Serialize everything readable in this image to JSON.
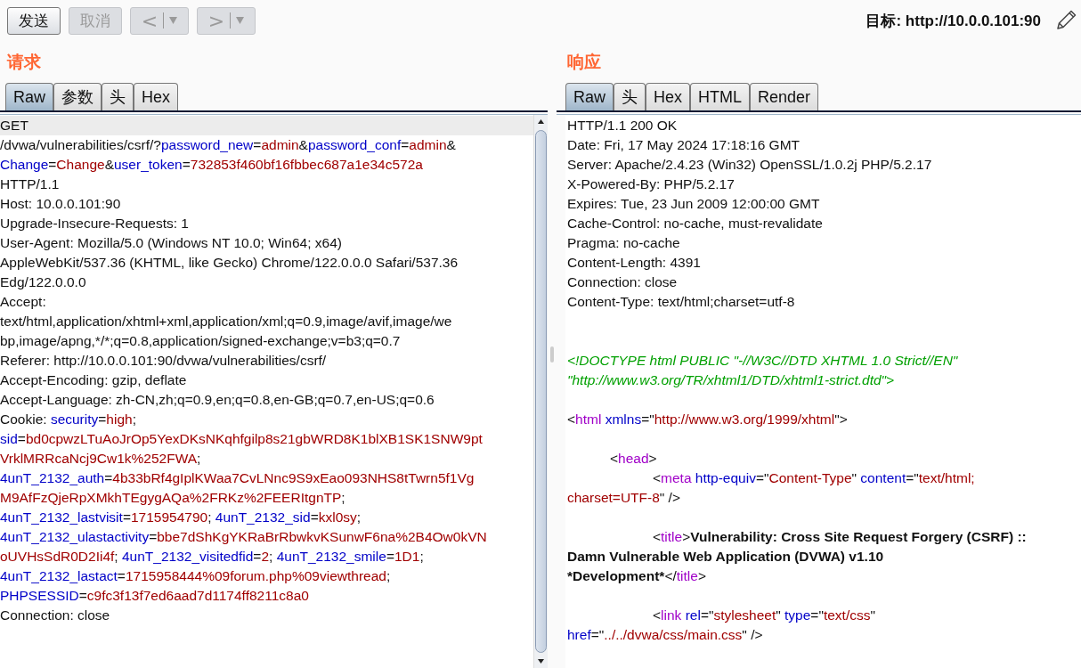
{
  "toolbar": {
    "buttons": [
      {
        "kind": "text",
        "label": "发送",
        "disabled": false
      },
      {
        "kind": "text",
        "label": "取消",
        "disabled": true
      },
      {
        "kind": "split",
        "label": "<",
        "disabled": true
      },
      {
        "kind": "split",
        "label": ">",
        "disabled": true
      }
    ],
    "target": "目标: http://10.0.0.101:90"
  },
  "request": {
    "heading": "请求",
    "tabs": [
      {
        "label": "Raw",
        "selected": true
      },
      {
        "label": "参数",
        "selected": false
      },
      {
        "label": "头",
        "selected": false
      },
      {
        "label": "Hex",
        "selected": false
      }
    ],
    "lines": [
      {
        "current": true,
        "segments": [
          {
            "kind": "plain",
            "text": "GET"
          }
        ]
      },
      {
        "current": false,
        "segments": [
          {
            "kind": "plain",
            "text": "/dvwa/vulnerabilities/csrf/?"
          },
          {
            "kind": "name",
            "text": "password_new"
          },
          {
            "kind": "plain",
            "text": "="
          },
          {
            "kind": "value",
            "text": "admin"
          },
          {
            "kind": "plain",
            "text": "&"
          },
          {
            "kind": "name",
            "text": "password_conf"
          },
          {
            "kind": "plain",
            "text": "="
          },
          {
            "kind": "value",
            "text": "admin"
          },
          {
            "kind": "plain",
            "text": "&"
          }
        ]
      },
      {
        "current": false,
        "segments": [
          {
            "kind": "name",
            "text": "Change"
          },
          {
            "kind": "plain",
            "text": "="
          },
          {
            "kind": "value",
            "text": "Change"
          },
          {
            "kind": "plain",
            "text": "&"
          },
          {
            "kind": "name",
            "text": "user_token"
          },
          {
            "kind": "plain",
            "text": "="
          },
          {
            "kind": "value",
            "text": "732853f460bf16fbbec687a1e34c572a"
          }
        ]
      },
      {
        "current": false,
        "segments": [
          {
            "kind": "plain",
            "text": "HTTP/1.1"
          }
        ]
      },
      {
        "current": false,
        "segments": [
          {
            "kind": "plain",
            "text": "Host: 10.0.0.101:90"
          }
        ]
      },
      {
        "current": false,
        "segments": [
          {
            "kind": "plain",
            "text": "Upgrade-Insecure-Requests: 1"
          }
        ]
      },
      {
        "current": false,
        "segments": [
          {
            "kind": "plain",
            "text": "User-Agent: Mozilla/5.0 (Windows NT 10.0; Win64; x64)"
          }
        ]
      },
      {
        "current": false,
        "segments": [
          {
            "kind": "plain",
            "text": "AppleWebKit/537.36 (KHTML, like Gecko) Chrome/122.0.0.0 Safari/537.36"
          }
        ]
      },
      {
        "current": false,
        "segments": [
          {
            "kind": "plain",
            "text": "Edg/122.0.0.0"
          }
        ]
      },
      {
        "current": false,
        "segments": [
          {
            "kind": "plain",
            "text": "Accept:"
          }
        ]
      },
      {
        "current": false,
        "segments": [
          {
            "kind": "plain",
            "text": "text/html,application/xhtml+xml,application/xml;q=0.9,image/avif,image/we"
          }
        ]
      },
      {
        "current": false,
        "segments": [
          {
            "kind": "plain",
            "text": "bp,image/apng,*/*;q=0.8,application/signed-exchange;v=b3;q=0.7"
          }
        ]
      },
      {
        "current": false,
        "segments": [
          {
            "kind": "plain",
            "text": "Referer: http://10.0.0.101:90/dvwa/vulnerabilities/csrf/"
          }
        ]
      },
      {
        "current": false,
        "segments": [
          {
            "kind": "plain",
            "text": "Accept-Encoding: gzip, deflate"
          }
        ]
      },
      {
        "current": false,
        "segments": [
          {
            "kind": "plain",
            "text": "Accept-Language: zh-CN,zh;q=0.9,en;q=0.8,en-GB;q=0.7,en-US;q=0.6"
          }
        ]
      },
      {
        "current": false,
        "segments": [
          {
            "kind": "plain",
            "text": "Cookie: "
          },
          {
            "kind": "name",
            "text": "security"
          },
          {
            "kind": "plain",
            "text": "="
          },
          {
            "kind": "value",
            "text": "high"
          },
          {
            "kind": "plain",
            "text": ";"
          }
        ]
      },
      {
        "current": false,
        "segments": [
          {
            "kind": "name",
            "text": "sid"
          },
          {
            "kind": "plain",
            "text": "="
          },
          {
            "kind": "value",
            "text": "bd0cpwzLTuAoJrOp5YexDKsNKqhfgilp8s21gbWRD8K1blXB1SK1SNW9pt"
          }
        ]
      },
      {
        "current": false,
        "segments": [
          {
            "kind": "value",
            "text": "VrklMRRcaNcj9Cw1k%252FWA"
          },
          {
            "kind": "plain",
            "text": ";"
          }
        ]
      },
      {
        "current": false,
        "segments": [
          {
            "kind": "name",
            "text": "4unT_2132_auth"
          },
          {
            "kind": "plain",
            "text": "="
          },
          {
            "kind": "value",
            "text": "4b33bRf4gIplKWaa7CvLNnc9S9xEao093NHS8tTwrn5f1Vg"
          }
        ]
      },
      {
        "current": false,
        "segments": [
          {
            "kind": "value",
            "text": "M9AfFzQjeRpXMkhTEgygAQa%2FRKz%2FEERItgnTP"
          },
          {
            "kind": "plain",
            "text": ";"
          }
        ]
      },
      {
        "current": false,
        "segments": [
          {
            "kind": "name",
            "text": "4unT_2132_lastvisit"
          },
          {
            "kind": "plain",
            "text": "="
          },
          {
            "kind": "value",
            "text": "1715954790"
          },
          {
            "kind": "plain",
            "text": "; "
          },
          {
            "kind": "name",
            "text": "4unT_2132_sid"
          },
          {
            "kind": "plain",
            "text": "="
          },
          {
            "kind": "value",
            "text": "kxl0sy"
          },
          {
            "kind": "plain",
            "text": ";"
          }
        ]
      },
      {
        "current": false,
        "segments": [
          {
            "kind": "name",
            "text": "4unT_2132_ulastactivity"
          },
          {
            "kind": "plain",
            "text": "="
          },
          {
            "kind": "value",
            "text": "bbe7dShKgYKRaBrRbwkvKSunwF6na%2B4Ow0kVN"
          }
        ]
      },
      {
        "current": false,
        "segments": [
          {
            "kind": "value",
            "text": "oUVHsSdR0D2Ii4f"
          },
          {
            "kind": "plain",
            "text": "; "
          },
          {
            "kind": "name",
            "text": "4unT_2132_visitedfid"
          },
          {
            "kind": "plain",
            "text": "="
          },
          {
            "kind": "value",
            "text": "2"
          },
          {
            "kind": "plain",
            "text": "; "
          },
          {
            "kind": "name",
            "text": "4unT_2132_smile"
          },
          {
            "kind": "plain",
            "text": "="
          },
          {
            "kind": "value",
            "text": "1D1"
          },
          {
            "kind": "plain",
            "text": ";"
          }
        ]
      },
      {
        "current": false,
        "segments": [
          {
            "kind": "name",
            "text": "4unT_2132_lastact"
          },
          {
            "kind": "plain",
            "text": "="
          },
          {
            "kind": "value",
            "text": "1715958444%09forum.php%09viewthread"
          },
          {
            "kind": "plain",
            "text": ";"
          }
        ]
      },
      {
        "current": false,
        "segments": [
          {
            "kind": "name",
            "text": "PHPSESSID"
          },
          {
            "kind": "plain",
            "text": "="
          },
          {
            "kind": "value",
            "text": "c9fc3f13f7ed6aad7d1174ff8211c8a0"
          }
        ]
      },
      {
        "current": false,
        "segments": [
          {
            "kind": "plain",
            "text": "Connection: close"
          }
        ]
      }
    ]
  },
  "response": {
    "heading": "响应",
    "tabs": [
      {
        "label": "Raw",
        "selected": true
      },
      {
        "label": "头",
        "selected": false
      },
      {
        "label": "Hex",
        "selected": false
      },
      {
        "label": "HTML",
        "selected": false
      },
      {
        "label": "Render",
        "selected": false
      }
    ],
    "lines": [
      {
        "kind": "text",
        "segments": [
          {
            "kind": "plain",
            "text": "HTTP/1.1 200 OK"
          }
        ]
      },
      {
        "kind": "text",
        "segments": [
          {
            "kind": "plain",
            "text": "Date: Fri, 17 May 2024 17:18:16 GMT"
          }
        ]
      },
      {
        "kind": "text",
        "segments": [
          {
            "kind": "plain",
            "text": "Server: Apache/2.4.23 (Win32) OpenSSL/1.0.2j PHP/5.2.17"
          }
        ]
      },
      {
        "kind": "text",
        "segments": [
          {
            "kind": "plain",
            "text": "X-Powered-By: PHP/5.2.17"
          }
        ]
      },
      {
        "kind": "text",
        "segments": [
          {
            "kind": "plain",
            "text": "Expires: Tue, 23 Jun 2009 12:00:00 GMT"
          }
        ]
      },
      {
        "kind": "text",
        "segments": [
          {
            "kind": "plain",
            "text": "Cache-Control: no-cache, must-revalidate"
          }
        ]
      },
      {
        "kind": "text",
        "segments": [
          {
            "kind": "plain",
            "text": "Pragma: no-cache"
          }
        ]
      },
      {
        "kind": "text",
        "segments": [
          {
            "kind": "plain",
            "text": "Content-Length: 4391"
          }
        ]
      },
      {
        "kind": "text",
        "segments": [
          {
            "kind": "plain",
            "text": "Connection: close"
          }
        ]
      },
      {
        "kind": "text",
        "segments": [
          {
            "kind": "plain",
            "text": "Content-Type: text/html;charset=utf-8"
          }
        ]
      },
      {
        "kind": "blank"
      },
      {
        "kind": "blank"
      },
      {
        "kind": "text",
        "segments": [
          {
            "kind": "doctype",
            "text": "<!DOCTYPE html PUBLIC \"-//W3C//DTD XHTML 1.0 Strict//EN\""
          }
        ]
      },
      {
        "kind": "text",
        "segments": [
          {
            "kind": "doctype",
            "text": "\"http://www.w3.org/TR/xhtml1/DTD/xhtml1-strict.dtd\">"
          }
        ]
      },
      {
        "kind": "blank"
      },
      {
        "kind": "text",
        "segments": [
          {
            "kind": "plain",
            "text": "<"
          },
          {
            "kind": "tag",
            "text": "html "
          },
          {
            "kind": "name",
            "text": "xmlns"
          },
          {
            "kind": "plain",
            "text": "=\""
          },
          {
            "kind": "value",
            "text": "http://www.w3.org/1999/xhtml"
          },
          {
            "kind": "plain",
            "text": "\">"
          }
        ]
      },
      {
        "kind": "blank"
      },
      {
        "kind": "text",
        "segments": [
          {
            "kind": "plain",
            "text": "\t<"
          },
          {
            "kind": "tag",
            "text": "head"
          },
          {
            "kind": "plain",
            "text": ">"
          }
        ]
      },
      {
        "kind": "text",
        "segments": [
          {
            "kind": "plain",
            "text": "\t\t<"
          },
          {
            "kind": "tag",
            "text": "meta "
          },
          {
            "kind": "name",
            "text": "http-equiv"
          },
          {
            "kind": "plain",
            "text": "=\""
          },
          {
            "kind": "value",
            "text": "Content-Type"
          },
          {
            "kind": "plain",
            "text": "\" "
          },
          {
            "kind": "name",
            "text": "content"
          },
          {
            "kind": "plain",
            "text": "=\""
          },
          {
            "kind": "value",
            "text": "text/html;"
          }
        ]
      },
      {
        "kind": "text",
        "segments": [
          {
            "kind": "value",
            "text": "charset=UTF-8"
          },
          {
            "kind": "plain",
            "text": "\" />"
          }
        ]
      },
      {
        "kind": "blank"
      },
      {
        "kind": "text",
        "segments": [
          {
            "kind": "plain",
            "text": "\t\t<"
          },
          {
            "kind": "tag",
            "text": "title"
          },
          {
            "kind": "plain",
            "text": ">"
          },
          {
            "kind": "bold",
            "text": "Vulnerability: Cross Site Request Forgery (CSRF) ::"
          }
        ]
      },
      {
        "kind": "text",
        "segments": [
          {
            "kind": "bold",
            "text": "Damn Vulnerable Web Application (DVWA) v1.10"
          }
        ]
      },
      {
        "kind": "text",
        "segments": [
          {
            "kind": "bold",
            "text": "*Development*"
          },
          {
            "kind": "plain",
            "text": "</"
          },
          {
            "kind": "tag",
            "text": "title"
          },
          {
            "kind": "plain",
            "text": ">"
          }
        ]
      },
      {
        "kind": "blank"
      },
      {
        "kind": "text",
        "segments": [
          {
            "kind": "plain",
            "text": "\t\t<"
          },
          {
            "kind": "tag",
            "text": "link "
          },
          {
            "kind": "name",
            "text": "rel"
          },
          {
            "kind": "plain",
            "text": "=\""
          },
          {
            "kind": "value",
            "text": "stylesheet"
          },
          {
            "kind": "plain",
            "text": "\" "
          },
          {
            "kind": "name",
            "text": "type"
          },
          {
            "kind": "plain",
            "text": "=\""
          },
          {
            "kind": "value",
            "text": "text/css"
          },
          {
            "kind": "plain",
            "text": "\""
          }
        ]
      },
      {
        "kind": "text",
        "segments": [
          {
            "kind": "name",
            "text": "href"
          },
          {
            "kind": "plain",
            "text": "=\""
          },
          {
            "kind": "value",
            "text": "../../dvwa/css/main.css"
          },
          {
            "kind": "plain",
            "text": "\" />"
          }
        ]
      }
    ]
  }
}
